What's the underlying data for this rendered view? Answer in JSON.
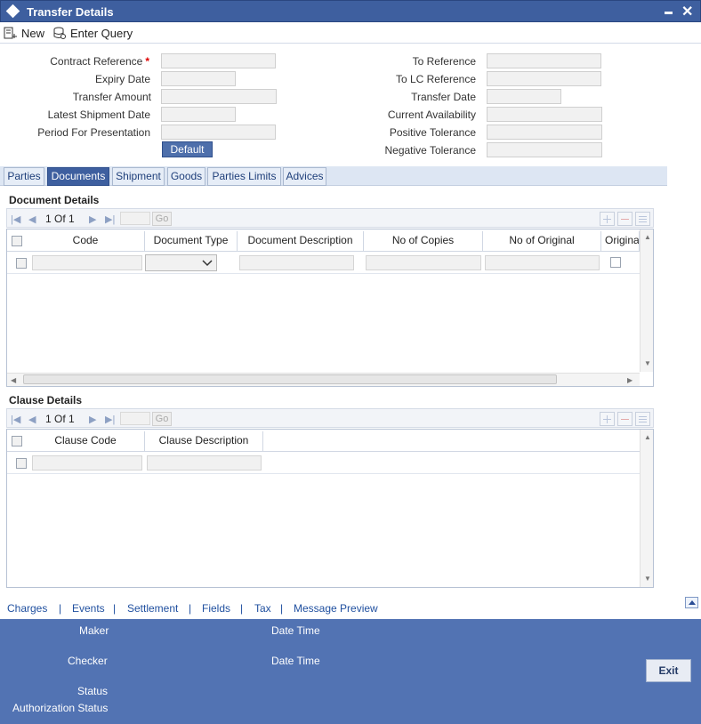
{
  "window": {
    "title": "Transfer Details"
  },
  "toolbar": {
    "new_label": "New",
    "enter_query_label": "Enter Query"
  },
  "form": {
    "contract_reference": "Contract Reference",
    "expiry_date": "Expiry Date",
    "transfer_amount": "Transfer Amount",
    "latest_shipment_date": "Latest Shipment Date",
    "period_for_presentation": "Period For Presentation",
    "default_button": "Default",
    "to_reference": "To Reference",
    "to_lc_reference": "To LC Reference",
    "transfer_date": "Transfer Date",
    "current_availability": "Current Availability",
    "positive_tolerance": "Positive Tolerance",
    "negative_tolerance": "Negative Tolerance",
    "required_marker": "*"
  },
  "tabs": [
    "Parties",
    "Documents",
    "Shipment",
    "Goods",
    "Parties Limits",
    "Advices"
  ],
  "active_tab": "Documents",
  "document_details": {
    "title": "Document Details",
    "page": "1",
    "of": "Of",
    "total": "1",
    "go": "Go",
    "columns": [
      "Code",
      "Document Type",
      "Document Description",
      "No of Copies",
      "No of Original",
      "Origina"
    ]
  },
  "clause_details": {
    "title": "Clause Details",
    "page": "1",
    "of": "Of",
    "total": "1",
    "go": "Go",
    "columns": [
      "Clause Code",
      "Clause Description"
    ]
  },
  "links": [
    "Charges",
    "Events",
    "Settlement",
    "Fields",
    "Tax",
    "Message Preview"
  ],
  "link_separator": "|",
  "footer": {
    "maker": "Maker",
    "date_time": "Date Time",
    "checker": "Checker",
    "status": "Status",
    "authorization_status": "Authorization Status",
    "exit": "Exit"
  },
  "colors": {
    "title_bar": "#3e5f9f",
    "footer": "#5273b3",
    "active_tab": "#3e5f9f",
    "link": "#1f4f9f",
    "required": "#dd0000"
  }
}
